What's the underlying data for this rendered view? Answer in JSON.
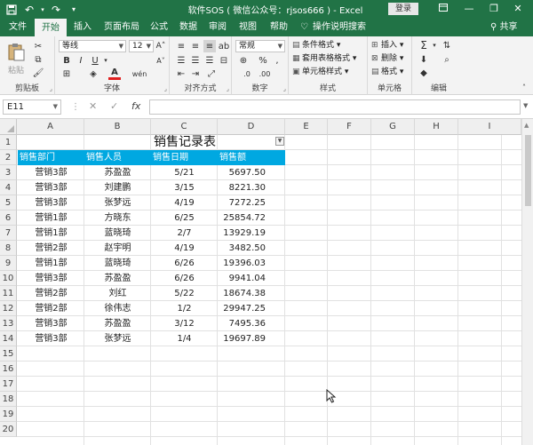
{
  "titlebar": {
    "title": "软件SOS ( 微信公众号：rjsos666 ) - Excel",
    "login": "登录",
    "icons": [
      "save-icon",
      "undo-icon",
      "redo-icon",
      "customize-qat-icon"
    ],
    "controls": [
      "ribbon-display-icon",
      "minimize-icon",
      "restore-icon",
      "close-icon"
    ]
  },
  "tabs": [
    {
      "label": "文件"
    },
    {
      "label": "开始"
    },
    {
      "label": "插入"
    },
    {
      "label": "页面布局"
    },
    {
      "label": "公式"
    },
    {
      "label": "数据"
    },
    {
      "label": "审阅"
    },
    {
      "label": "视图"
    },
    {
      "label": "帮助"
    }
  ],
  "tell_me": "操作说明搜索",
  "share": "共享",
  "ribbon": {
    "clipboard": {
      "label": "剪贴板",
      "paste": "粘贴"
    },
    "font": {
      "label": "字体",
      "name": "等线",
      "size": "12"
    },
    "alignment": {
      "label": "对齐方式"
    },
    "number": {
      "label": "数字",
      "format": "常规"
    },
    "styles": {
      "label": "样式",
      "conditional": "条件格式",
      "table": "套用表格格式",
      "cell": "单元格样式"
    },
    "cells": {
      "label": "单元格",
      "insert": "插入",
      "delete": "删除",
      "format": "格式"
    },
    "editing": {
      "label": "编辑"
    }
  },
  "formula_bar": {
    "name_box": "E11",
    "formula": ""
  },
  "sheet": {
    "columns": [
      "A",
      "B",
      "C",
      "D",
      "E",
      "F",
      "G",
      "H",
      "I"
    ],
    "rows": [
      "1",
      "2",
      "3",
      "4",
      "5",
      "6",
      "7",
      "8",
      "9",
      "10",
      "11",
      "12",
      "13",
      "14",
      "15",
      "16",
      "17",
      "18",
      "19",
      "20"
    ],
    "title": "销售记录表",
    "headers": [
      "销售部门",
      "销售人员",
      "销售日期",
      "销售额"
    ],
    "header_color": "#00a8e1",
    "records": [
      [
        "营销3部",
        "苏盈盈",
        "5/21",
        "5697.50"
      ],
      [
        "营销3部",
        "刘建鹏",
        "3/15",
        "8221.30"
      ],
      [
        "营销3部",
        "张梦远",
        "4/19",
        "7272.25"
      ],
      [
        "营销1部",
        "方晓东",
        "6/25",
        "25854.72"
      ],
      [
        "营销1部",
        "蓝晓琦",
        "2/7",
        "13929.19"
      ],
      [
        "营销2部",
        "赵宇明",
        "4/19",
        "3482.50"
      ],
      [
        "营销1部",
        "蓝晓琦",
        "6/26",
        "19396.03"
      ],
      [
        "营销3部",
        "苏盈盈",
        "6/26",
        "9941.04"
      ],
      [
        "营销2部",
        "刘红",
        "5/22",
        "18674.38"
      ],
      [
        "营销2部",
        "徐伟志",
        "1/2",
        "29947.25"
      ],
      [
        "营销3部",
        "苏盈盈",
        "3/12",
        "7495.36"
      ],
      [
        "营销3部",
        "张梦远",
        "1/4",
        "19697.89"
      ]
    ]
  }
}
